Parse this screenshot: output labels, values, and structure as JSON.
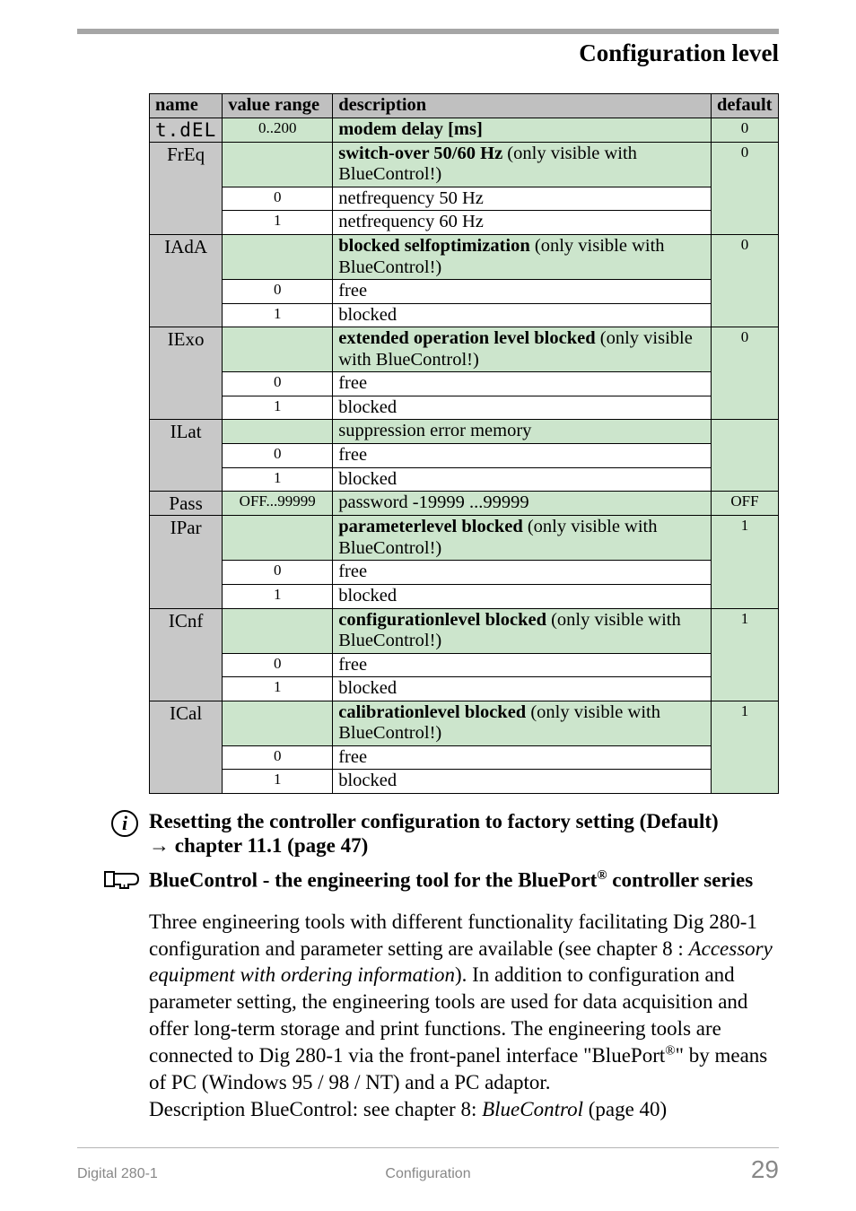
{
  "header": {
    "title": "Configuration level"
  },
  "table": {
    "head": {
      "name": "name",
      "vr": "value range",
      "desc": "description",
      "def": "default"
    },
    "rows": [
      {
        "name_class": "seg7",
        "name": "t.dEL",
        "name_rowspan": 1,
        "items": [
          {
            "vr": "0..200",
            "desc": "modem delay [ms]",
            "def": "0",
            "green": true,
            "bold_desc": true
          }
        ]
      },
      {
        "name": "FrEq",
        "name_rowspan": 3,
        "items": [
          {
            "vr": "",
            "desc_bold": "switch-over 50/60 Hz",
            "desc_rest": "  (only visible with BlueControl!)",
            "def": "0",
            "green": true
          },
          {
            "vr": "0",
            "desc": "netfrequency 50 Hz",
            "def": ""
          },
          {
            "vr": "1",
            "desc": "netfrequency 60 Hz",
            "def": ""
          }
        ]
      },
      {
        "name": "IAdA",
        "name_rowspan": 3,
        "items": [
          {
            "vr": "",
            "desc_bold": "blocked  selfoptimization",
            "desc_rest": "  (only visible with BlueControl!)",
            "def": "0",
            "green": true
          },
          {
            "vr": "0",
            "desc": "free",
            "def": ""
          },
          {
            "vr": "1",
            "desc": "blocked",
            "def": ""
          }
        ]
      },
      {
        "name": "IExo",
        "name_rowspan": 3,
        "items": [
          {
            "vr": "",
            "desc_bold": "extended operation level blocked",
            "desc_rest": " (only visible with BlueControl!)",
            "def": "0",
            "green": true
          },
          {
            "vr": "0",
            "desc": "free",
            "def": ""
          },
          {
            "vr": "1",
            "desc": "blocked",
            "def": ""
          }
        ]
      },
      {
        "name": "ILat",
        "name_rowspan": 3,
        "items": [
          {
            "vr": "",
            "desc_plain": "suppression error memory",
            "def": "",
            "green": true
          },
          {
            "vr": "0",
            "desc": "free",
            "def": ""
          },
          {
            "vr": "1",
            "desc": "blocked",
            "def": ""
          }
        ]
      },
      {
        "name": "Pass",
        "name_rowspan": 1,
        "items": [
          {
            "vr": "OFF...99999",
            "desc_plain": "password -19999 ...99999",
            "def": "OFF",
            "green": true
          }
        ]
      },
      {
        "name": "IPar",
        "name_rowspan": 3,
        "items": [
          {
            "vr": "",
            "desc_bold": "parameterlevel blocked",
            "desc_rest": "  (only visible with BlueControl!)",
            "def": "1",
            "green": true
          },
          {
            "vr": "0",
            "desc": "free",
            "def": ""
          },
          {
            "vr": "1",
            "desc": "blocked",
            "def": ""
          }
        ]
      },
      {
        "name": "ICnf",
        "name_rowspan": 3,
        "items": [
          {
            "vr": "",
            "desc_bold": "configurationlevel blocked",
            "desc_rest": " (only visible with BlueControl!)",
            "def": "1",
            "green": true
          },
          {
            "vr": "0",
            "desc": "free",
            "def": ""
          },
          {
            "vr": "1",
            "desc": "blocked",
            "def": ""
          }
        ]
      },
      {
        "name": "ICal",
        "name_rowspan": 3,
        "items": [
          {
            "vr": "",
            "desc_bold": "calibrationlevel blocked",
            "desc_rest": " (only visible with BlueControl!)",
            "def": "1",
            "green": true
          },
          {
            "vr": "0",
            "desc": "free",
            "def": ""
          },
          {
            "vr": "1",
            "desc": "blocked",
            "def": ""
          }
        ]
      }
    ]
  },
  "note1_line1": "Resetting the controller configuration to factory setting (Default)",
  "note1_line2a": "  chapter  11.1  (page 47)",
  "note2_pre": "BlueControl - the engineering tool for the BluePort",
  "note2_post": " controller series",
  "body1": "Three engineering tools with different functionality facilitating  Dig 280-1 configuration and parameter setting are available (see chapter 8 : ",
  "body1_ital": "Accessory equipment with ordering information",
  "body1_cont": "). In addition to configuration and parameter setting, the engineering tools are used for data acquisition and offer long-term storage and print functions. The engineering tools are connected to Dig 280-1 via the front-panel interface \"BluePort",
  "body1_cont2": "\" by means of  PC (Windows 95 / 98 / NT) and a PC adaptor.",
  "body2": "Description BlueControl: see chapter 8: ",
  "body2_ital": "BlueControl",
  "body2_cont": "  (page 40)",
  "footer": {
    "left": "Digital 280-1",
    "center": "Configuration",
    "right": "29"
  }
}
